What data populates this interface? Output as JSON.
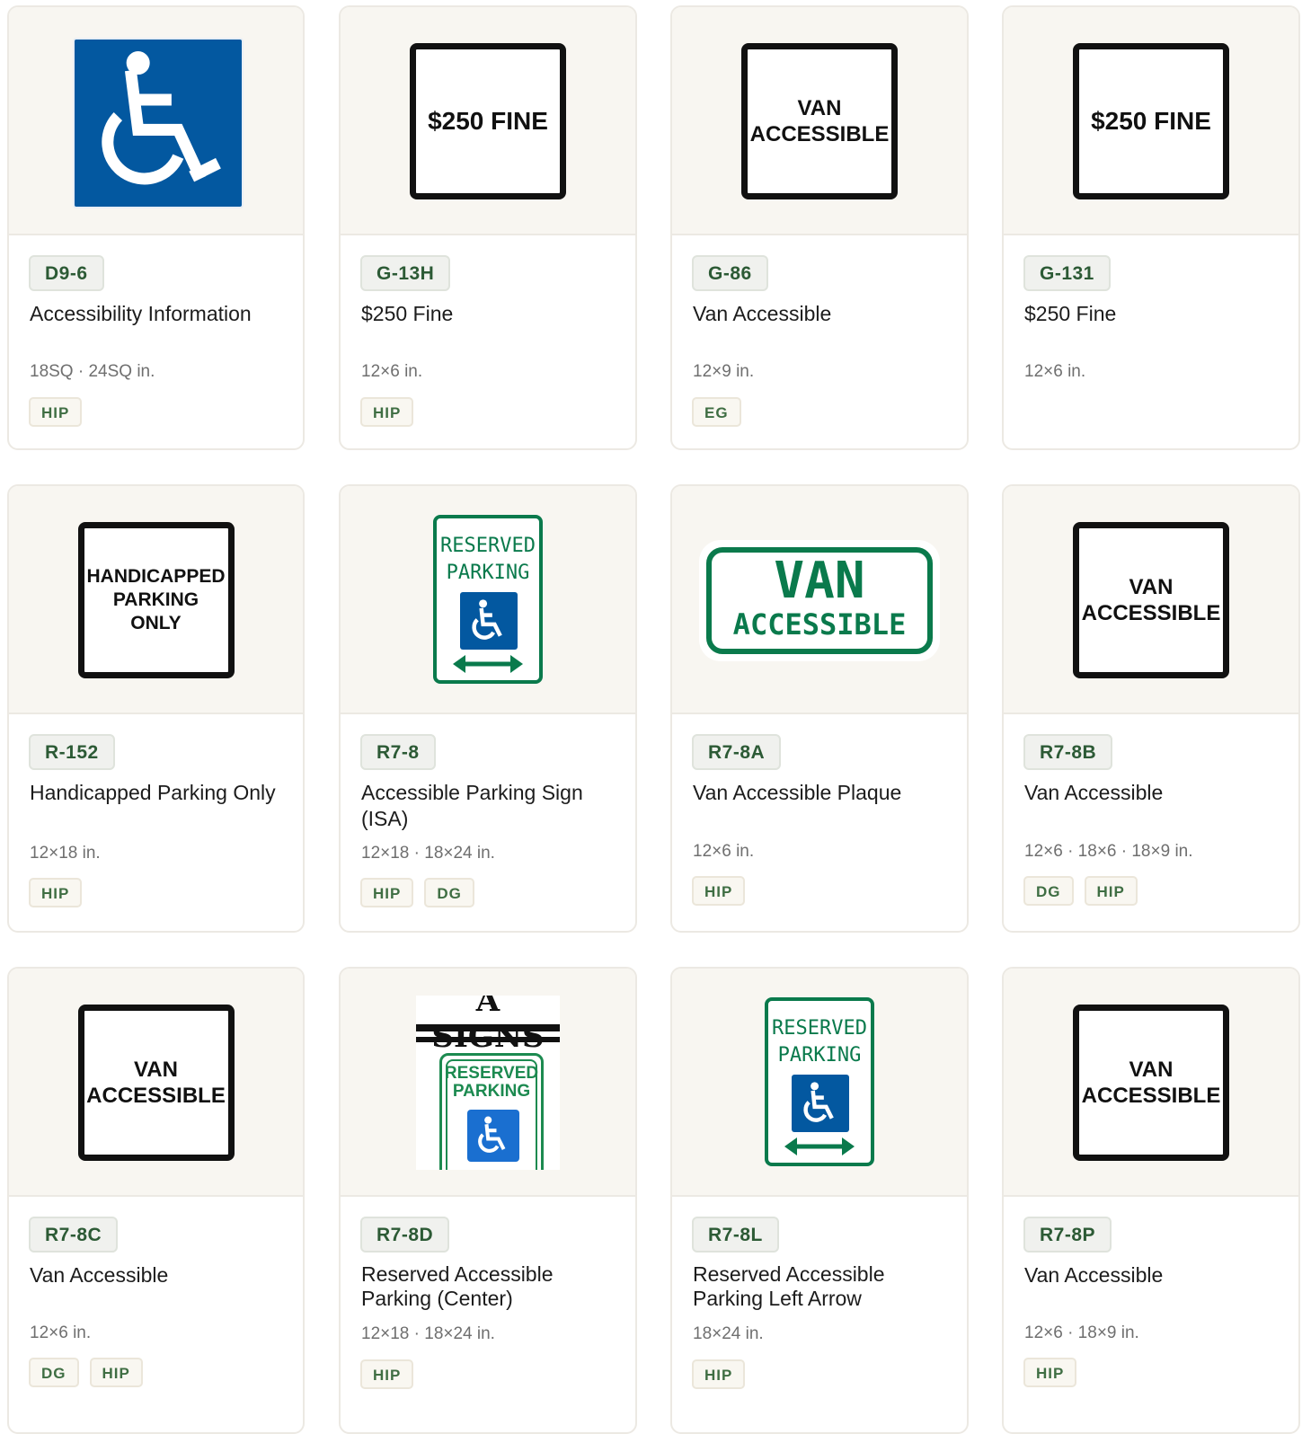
{
  "cards": [
    {
      "code": "D9-6",
      "title": "Accessibility Information",
      "sizes": "18SQ · 24SQ in.",
      "tags": [
        "HIP"
      ]
    },
    {
      "code": "G-13H",
      "title": "$250 Fine",
      "sizes": "12×6 in.",
      "tags": [
        "HIP"
      ],
      "sign_text": [
        "$250 FINE"
      ]
    },
    {
      "code": "G-86",
      "title": "Van Accessible",
      "sizes": "12×9 in.",
      "tags": [
        "EG"
      ],
      "sign_text": [
        "VAN",
        "ACCESSIBLE"
      ]
    },
    {
      "code": "G-131",
      "title": "$250 Fine",
      "sizes": "12×6 in.",
      "tags": [],
      "sign_text": [
        "$250 FINE"
      ]
    },
    {
      "code": "R-152",
      "title": "Handicapped Parking Only",
      "sizes": "12×18 in.",
      "tags": [
        "HIP"
      ],
      "sign_text": [
        "HANDICAPPED",
        "PARKING",
        "ONLY"
      ]
    },
    {
      "code": "R7-8",
      "title": "Accessible Parking Sign (ISA)",
      "sizes": "12×18 · 18×24 in.",
      "tags": [
        "HIP",
        "DG"
      ],
      "sign_text": [
        "RESERVED",
        "PARKING"
      ]
    },
    {
      "code": "R7-8A",
      "title": "Van Accessible Plaque",
      "sizes": "12×6 in.",
      "tags": [
        "HIP"
      ],
      "sign_text": [
        "VAN",
        "ACCESSIBLE"
      ]
    },
    {
      "code": "R7-8B",
      "title": "Van Accessible",
      "sizes": "12×6 · 18×6 · 18×9 in.",
      "tags": [
        "DG",
        "HIP"
      ],
      "sign_text": [
        "VAN",
        "ACCESSIBLE"
      ]
    },
    {
      "code": "R7-8C",
      "title": "Van Accessible",
      "sizes": "12×6 in.",
      "tags": [
        "DG",
        "HIP"
      ],
      "sign_text": [
        "VAN",
        "ACCESSIBLE"
      ]
    },
    {
      "code": "R7-8D",
      "title": "Reserved Accessible Parking (Center)",
      "sizes": "12×18 · 18×24 in.",
      "tags": [
        "HIP"
      ],
      "sign_text": [
        "A SIGNS",
        "RESERVED",
        "PARKING"
      ]
    },
    {
      "code": "R7-8L",
      "title": "Reserved Accessible Parking Left Arrow",
      "sizes": "18×24 in.",
      "tags": [
        "HIP"
      ],
      "sign_text": [
        "RESERVED",
        "PARKING"
      ]
    },
    {
      "code": "R7-8P",
      "title": "Van Accessible",
      "sizes": "12×6 · 18×9 in.",
      "tags": [
        "HIP"
      ],
      "sign_text": [
        "VAN",
        "ACCESSIBLE"
      ]
    }
  ],
  "colors": {
    "brand_green": "#2c5a35",
    "sign_green": "#0a7a4c",
    "isa_blue": "#0358a0"
  },
  "icons": [
    "wheelchair-icon",
    "double-arrow-icon"
  ]
}
